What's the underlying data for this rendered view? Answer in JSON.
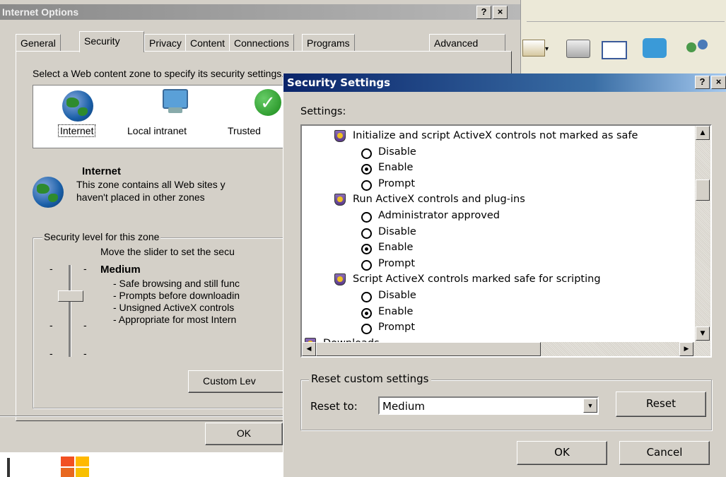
{
  "internet_options": {
    "title": "Internet Options",
    "help_btn": "?",
    "close_btn": "×",
    "tabs": [
      "General",
      "Security",
      "Privacy",
      "Content",
      "Connections",
      "Programs",
      "Advanced"
    ],
    "zone_prompt": "Select a Web content zone to specify its security settings.",
    "zones": [
      "Internet",
      "Local intranet",
      "Trusted"
    ],
    "zone_heading": "Internet",
    "zone_desc_1": "This zone contains all Web sites y",
    "zone_desc_2": "haven't placed in other zones",
    "security_level_label": "Security level for this zone",
    "slider_hint": "Move the slider to set the secu",
    "level_name": "Medium",
    "level_points": [
      "- Safe browsing and still func",
      "- Prompts before downloadin",
      "- Unsigned ActiveX controls",
      "- Appropriate for most Intern"
    ],
    "custom_level_btn": "Custom Lev",
    "ok_btn": "OK"
  },
  "security_settings": {
    "title": "Security Settings",
    "help_btn": "?",
    "close_btn": "×",
    "settings_label": "Settings:",
    "items": [
      {
        "kind": "header",
        "text": "Initialize and script ActiveX controls not marked as safe"
      },
      {
        "kind": "option",
        "text": "Disable",
        "checked": false
      },
      {
        "kind": "option",
        "text": "Enable",
        "checked": true
      },
      {
        "kind": "option",
        "text": "Prompt",
        "checked": false
      },
      {
        "kind": "header",
        "text": "Run ActiveX controls and plug-ins"
      },
      {
        "kind": "option",
        "text": "Administrator approved",
        "checked": false
      },
      {
        "kind": "option",
        "text": "Disable",
        "checked": false
      },
      {
        "kind": "option",
        "text": "Enable",
        "checked": true
      },
      {
        "kind": "option",
        "text": "Prompt",
        "checked": false
      },
      {
        "kind": "header",
        "text": "Script ActiveX controls marked safe for scripting"
      },
      {
        "kind": "option",
        "text": "Disable",
        "checked": false
      },
      {
        "kind": "option",
        "text": "Enable",
        "checked": true
      },
      {
        "kind": "option",
        "text": "Prompt",
        "checked": false
      },
      {
        "kind": "section",
        "text": "Downloads"
      }
    ],
    "reset_group_label": "Reset custom settings",
    "reset_to_label": "Reset to:",
    "reset_to_value": "Medium",
    "reset_btn": "Reset",
    "ok_btn": "OK",
    "cancel_btn": "Cancel"
  }
}
